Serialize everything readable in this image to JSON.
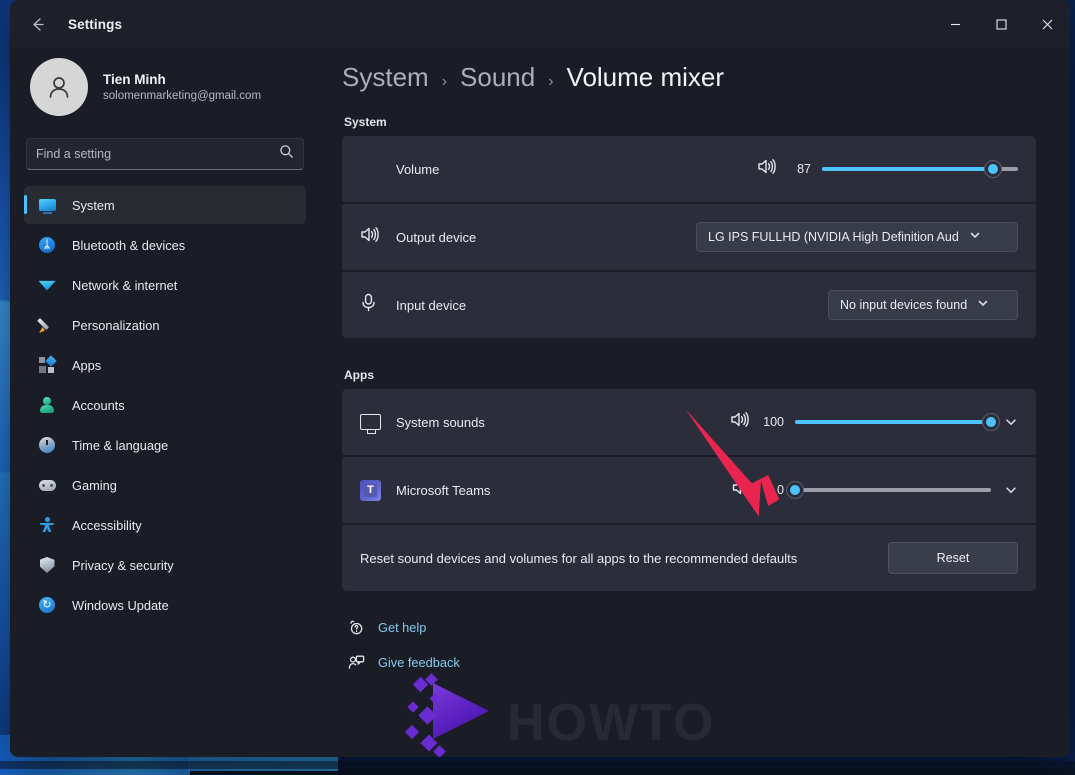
{
  "window": {
    "app_title": "Settings",
    "back_icon": "back-arrow-icon",
    "minimize_label": "Minimize",
    "maximize_label": "Maximize",
    "close_label": "Close"
  },
  "account": {
    "name": "Tien Minh",
    "email": "solomenmarketing@gmail.com",
    "avatar_icon": "person-avatar-icon"
  },
  "search": {
    "placeholder": "Find a setting",
    "value": "",
    "icon": "search-icon"
  },
  "sidebar": {
    "items": [
      {
        "label": "System",
        "icon": "monitor-icon",
        "active": true
      },
      {
        "label": "Bluetooth & devices",
        "icon": "bluetooth-icon",
        "active": false
      },
      {
        "label": "Network & internet",
        "icon": "wifi-icon",
        "active": false
      },
      {
        "label": "Personalization",
        "icon": "paintbrush-icon",
        "active": false
      },
      {
        "label": "Apps",
        "icon": "apps-grid-icon",
        "active": false
      },
      {
        "label": "Accounts",
        "icon": "account-person-icon",
        "active": false
      },
      {
        "label": "Time & language",
        "icon": "clock-icon",
        "active": false
      },
      {
        "label": "Gaming",
        "icon": "gamepad-icon",
        "active": false
      },
      {
        "label": "Accessibility",
        "icon": "accessibility-icon",
        "active": false
      },
      {
        "label": "Privacy & security",
        "icon": "shield-icon",
        "active": false
      },
      {
        "label": "Windows Update",
        "icon": "refresh-icon",
        "active": false
      }
    ]
  },
  "breadcrumb": {
    "root": "System",
    "parent": "Sound",
    "current": "Volume mixer",
    "separator": "›"
  },
  "system_section": {
    "label": "System",
    "volume": {
      "label": "Volume",
      "icon": "speaker-volume-icon",
      "value": 87,
      "min": 0,
      "max": 100
    },
    "output_device": {
      "label": "Output device",
      "icon": "speaker-icon",
      "selected": "LG IPS FULLHD (NVIDIA High Definition Aud",
      "chevron": "chevron-down-icon"
    },
    "input_device": {
      "label": "Input device",
      "icon": "microphone-icon",
      "selected": "No input devices found",
      "chevron": "chevron-down-icon"
    }
  },
  "apps_section": {
    "label": "Apps",
    "apps": [
      {
        "name": "System sounds",
        "icon": "monitor-outline-icon",
        "volume_icon": "speaker-volume-icon",
        "value": 100,
        "muted": false,
        "chevron": "chevron-down-icon"
      },
      {
        "name": "Microsoft Teams",
        "icon": "microsoft-teams-icon",
        "volume_icon": "speaker-mute-icon",
        "value": 0,
        "muted": true,
        "chevron": "chevron-down-icon"
      }
    ],
    "reset": {
      "description": "Reset sound devices and volumes for all apps to the recommended defaults",
      "button_label": "Reset"
    }
  },
  "footer": {
    "links": [
      {
        "label": "Get help",
        "icon": "help-question-icon"
      },
      {
        "label": "Give feedback",
        "icon": "feedback-person-icon"
      }
    ]
  },
  "watermark": {
    "text": "HOWTO",
    "logo_icon": "howto-diamond-logo-icon"
  },
  "annotation": {
    "arrow_icon": "red-arrow-pointer-icon",
    "color": "#e8254f",
    "points_at": "Microsoft Teams mute icon"
  },
  "colors": {
    "accent": "#4cc2ff",
    "card_bg": "#2b2d3a",
    "window_bg": "#1b1d26",
    "titlebar_bg": "#1e2029",
    "link": "#83caf0",
    "arrow_red": "#e8254f"
  }
}
